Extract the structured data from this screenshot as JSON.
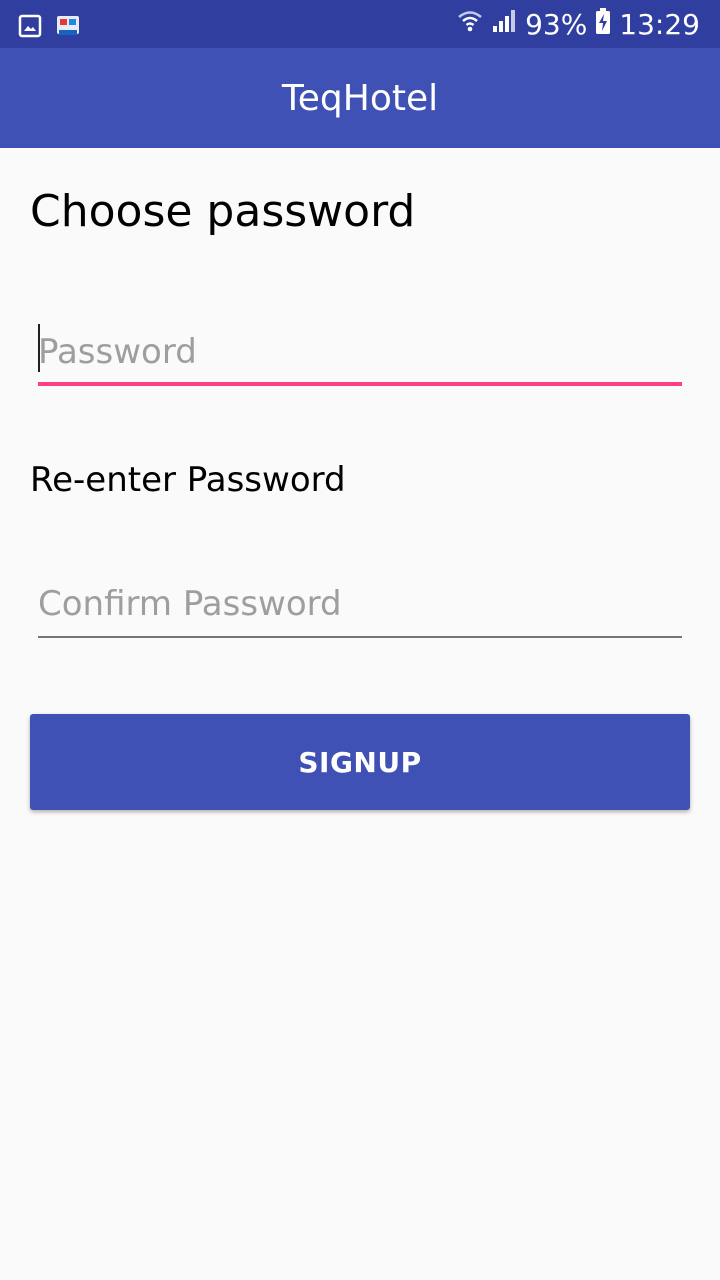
{
  "status_bar": {
    "battery": "93%",
    "time": "13:29",
    "icons": [
      "gallery-icon",
      "app-notification-icon",
      "wifi-icon",
      "signal-icon",
      "battery-charging-icon"
    ]
  },
  "app_bar": {
    "title": "TeqHotel"
  },
  "form": {
    "heading": "Choose password",
    "password_placeholder": "Password",
    "reenter_label": "Re-enter Password",
    "confirm_placeholder": "Confirm Password",
    "signup_label": "SIGNUP"
  },
  "colors": {
    "status_bar": "#303f9f",
    "primary": "#3f51b5",
    "accent": "#ff4081",
    "background": "#fafafa"
  }
}
